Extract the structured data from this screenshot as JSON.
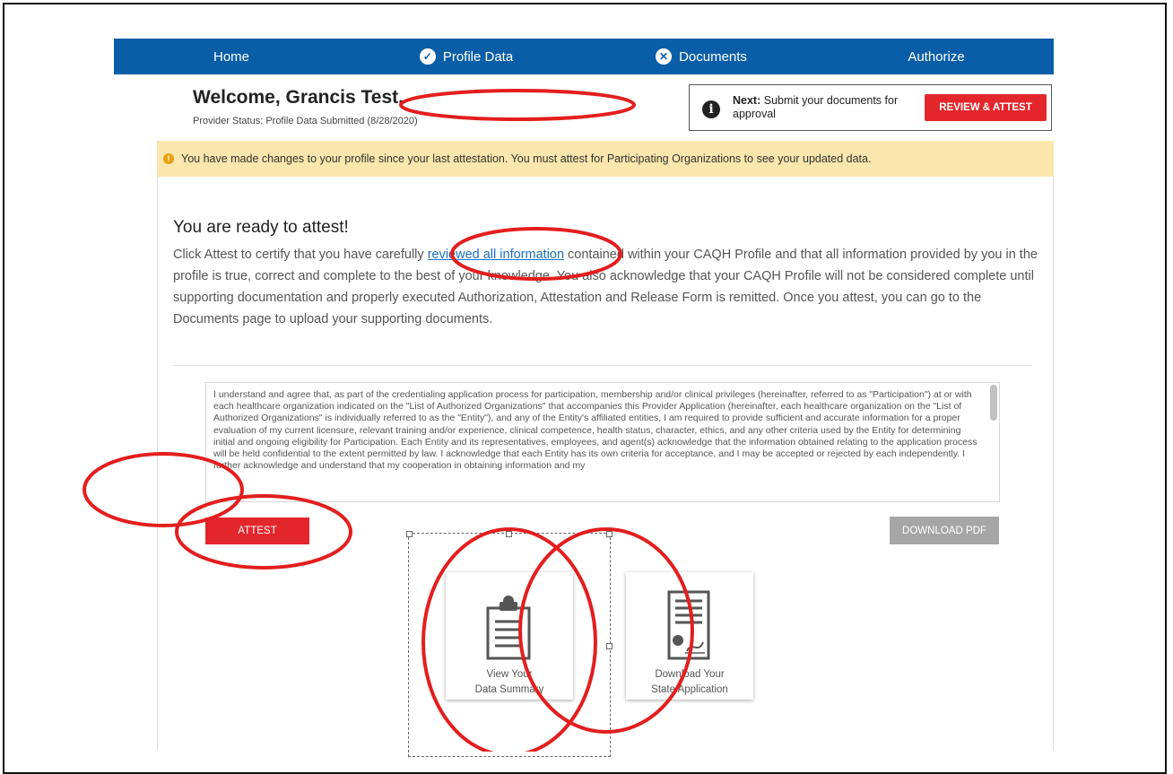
{
  "nav": {
    "items": [
      {
        "label": "Home",
        "icon": ""
      },
      {
        "label": "Profile Data",
        "icon": "check-circle-icon"
      },
      {
        "label": "Documents",
        "icon": "x-circle-icon"
      },
      {
        "label": "Authorize",
        "icon": ""
      }
    ]
  },
  "header": {
    "welcome": "Welcome, Grancis Test.",
    "status": "Provider Status:  Profile Data Submitted (8/28/2020)",
    "next_label": "Next:",
    "next_text": "Submit your documents for approval",
    "review_button": "REVIEW & ATTEST"
  },
  "alert": {
    "text": "You have made changes to your profile since your last attestation. You must attest for Participating Organizations to see your updated data."
  },
  "attest": {
    "title": "You are ready to attest!",
    "text_before": "Click Attest to certify that you have carefully ",
    "link": "reviewed all information",
    "text_after": " contained within your CAQH Profile and that all information provided by you in the profile is true, correct and complete to the best of your knowledge. You also acknowledge that your CAQH Profile will not be considered complete until supporting documentation and properly executed Authorization, Attestation and Release Form is remitted. Once you attest, you can go to the Documents page to upload your supporting documents.",
    "terms": "I understand and agree that, as part of the credentialing application process for participation, membership and/or clinical privileges (hereinafter, referred to as \"Participation\") at or with each healthcare organization indicated on the \"List of Authorized Organizations\" that accompanies this Provider Application (hereinafter, each healthcare organization on the \"List of Authorized Organizations\" is individually referred to as the \"Entity\"), and any of the Entity's affiliated entities, I am required to provide sufficient and accurate information for a proper evaluation of my current licensure, relevant training and/or experience, clinical competence, health status, character, ethics, and any other criteria used by the Entity for determining initial and ongoing eligibility for Participation. Each Entity and its representatives, employees, and agent(s) acknowledge that the information obtained relating to the application process will be held confidential to the extent permitted by law. I acknowledge that each Entity has its own criteria for acceptance, and I may be accepted or rejected by each independently. I further acknowledge and understand that my cooperation in obtaining information and my",
    "attest_button": "ATTEST",
    "download_pdf_button": "DOWNLOAD PDF"
  },
  "cards": [
    {
      "label_line1": "View Your",
      "label_line2": "Data Summary",
      "icon": "clipboard-icon"
    },
    {
      "label_line1": "Download Your",
      "label_line2": "State Application",
      "icon": "certificate-icon"
    }
  ],
  "colors": {
    "nav_bg": "#0a5ea8",
    "accent_red": "#e3262c",
    "alert_bg": "#fbe6ad",
    "annotation_red": "#e41e1e"
  }
}
